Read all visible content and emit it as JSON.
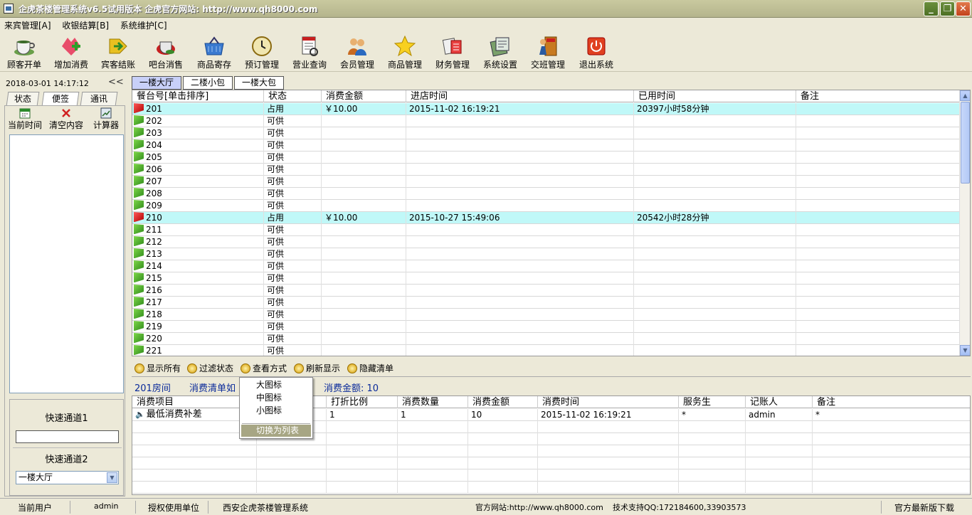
{
  "window": {
    "title": "企虎茶楼管理系统v6.5试用版本  企虎官方网站: http://www.qh8000.com",
    "min_label": "_",
    "max_label": "❐",
    "close_label": "✕"
  },
  "menu": [
    "来宾管理[A]",
    "收银结算[B]",
    "系统维护[C]"
  ],
  "toolbar": [
    {
      "label": "顾客开单",
      "icon": "teacup-icon"
    },
    {
      "label": "增加消费",
      "icon": "add-consumption-icon"
    },
    {
      "label": "宾客结账",
      "icon": "checkout-arrow-icon"
    },
    {
      "label": "吧台消售",
      "icon": "bar-sales-icon"
    },
    {
      "label": "商品寄存",
      "icon": "basket-icon"
    },
    {
      "label": "预订管理",
      "icon": "clock-icon"
    },
    {
      "label": "营业查询",
      "icon": "report-query-icon"
    },
    {
      "label": "会员管理",
      "icon": "members-icon"
    },
    {
      "label": "商品管理",
      "icon": "star-icon"
    },
    {
      "label": "财务管理",
      "icon": "finance-icon"
    },
    {
      "label": "系统设置",
      "icon": "settings-icon"
    },
    {
      "label": "交班管理",
      "icon": "shift-exit-icon"
    },
    {
      "label": "退出系统",
      "icon": "power-icon"
    }
  ],
  "left": {
    "datetime": "2018-03-01  14:17:12",
    "collapse_label": "<<",
    "tabs": [
      "状态",
      "便签",
      "通讯"
    ],
    "tools": [
      "当前时间",
      "清空内容",
      "计算器"
    ],
    "quick1_label": "快速通道1",
    "quick2_label": "快速通道2",
    "quick2_value": "一楼大厅"
  },
  "room_tabs": [
    "一楼大厅",
    "二楼小包",
    "一楼大包"
  ],
  "table": {
    "headers": [
      "餐台号[单击排序]",
      "状态",
      "消费金额",
      "进店时间",
      "已用时间",
      "备注"
    ],
    "rows": [
      {
        "no": "201",
        "status": "占用",
        "amount": "￥10.00",
        "time_in": "2015-11-02 16:19:21",
        "used": "20397小时58分钟",
        "note": "",
        "busy": true
      },
      {
        "no": "202",
        "status": "可供",
        "amount": "",
        "time_in": "",
        "used": "",
        "note": "",
        "busy": false
      },
      {
        "no": "203",
        "status": "可供",
        "amount": "",
        "time_in": "",
        "used": "",
        "note": "",
        "busy": false
      },
      {
        "no": "204",
        "status": "可供",
        "amount": "",
        "time_in": "",
        "used": "",
        "note": "",
        "busy": false
      },
      {
        "no": "205",
        "status": "可供",
        "amount": "",
        "time_in": "",
        "used": "",
        "note": "",
        "busy": false
      },
      {
        "no": "206",
        "status": "可供",
        "amount": "",
        "time_in": "",
        "used": "",
        "note": "",
        "busy": false
      },
      {
        "no": "207",
        "status": "可供",
        "amount": "",
        "time_in": "",
        "used": "",
        "note": "",
        "busy": false
      },
      {
        "no": "208",
        "status": "可供",
        "amount": "",
        "time_in": "",
        "used": "",
        "note": "",
        "busy": false
      },
      {
        "no": "209",
        "status": "可供",
        "amount": "",
        "time_in": "",
        "used": "",
        "note": "",
        "busy": false
      },
      {
        "no": "210",
        "status": "占用",
        "amount": "￥10.00",
        "time_in": "2015-10-27 15:49:06",
        "used": "20542小时28分钟",
        "note": "",
        "busy": true
      },
      {
        "no": "211",
        "status": "可供",
        "amount": "",
        "time_in": "",
        "used": "",
        "note": "",
        "busy": false
      },
      {
        "no": "212",
        "status": "可供",
        "amount": "",
        "time_in": "",
        "used": "",
        "note": "",
        "busy": false
      },
      {
        "no": "213",
        "status": "可供",
        "amount": "",
        "time_in": "",
        "used": "",
        "note": "",
        "busy": false
      },
      {
        "no": "214",
        "status": "可供",
        "amount": "",
        "time_in": "",
        "used": "",
        "note": "",
        "busy": false
      },
      {
        "no": "215",
        "status": "可供",
        "amount": "",
        "time_in": "",
        "used": "",
        "note": "",
        "busy": false
      },
      {
        "no": "216",
        "status": "可供",
        "amount": "",
        "time_in": "",
        "used": "",
        "note": "",
        "busy": false
      },
      {
        "no": "217",
        "status": "可供",
        "amount": "",
        "time_in": "",
        "used": "",
        "note": "",
        "busy": false
      },
      {
        "no": "218",
        "status": "可供",
        "amount": "",
        "time_in": "",
        "used": "",
        "note": "",
        "busy": false
      },
      {
        "no": "219",
        "status": "可供",
        "amount": "",
        "time_in": "",
        "used": "",
        "note": "",
        "busy": false
      },
      {
        "no": "220",
        "status": "可供",
        "amount": "",
        "time_in": "",
        "used": "",
        "note": "",
        "busy": false
      },
      {
        "no": "221",
        "status": "可供",
        "amount": "",
        "time_in": "",
        "used": "",
        "note": "",
        "busy": false
      }
    ]
  },
  "actions": [
    "显示所有",
    "过滤状态",
    "查看方式",
    "刷新显示",
    "隐藏清单"
  ],
  "info": {
    "room": "201房间",
    "list_label": "消费清单如",
    "amount_label": "消费金额: 10"
  },
  "detail": {
    "headers": [
      "消费项目",
      "",
      "打折比例",
      "消费数量",
      "消费金额",
      "消费时间",
      "服务生",
      "记账人",
      "备注"
    ],
    "rows": [
      {
        "item": "最低消费补差",
        "blank": "",
        "discount": "1",
        "qty": "1",
        "amount": "10",
        "time": "2015-11-02 16:19:21",
        "waiter": "*",
        "clerk": "admin",
        "note": "*"
      }
    ]
  },
  "context_menu": [
    "大图标",
    "中图标",
    "小图标",
    "切换为列表"
  ],
  "status": {
    "user_label": "当前用户",
    "user": "admin",
    "licensee_label": "授权使用单位",
    "licensee": "西安企虎茶楼管理系统",
    "site": "官方网站:http://www.qh8000.com",
    "support": "技术支持QQ:172184600,33903573",
    "download": "官方最新版下载"
  }
}
